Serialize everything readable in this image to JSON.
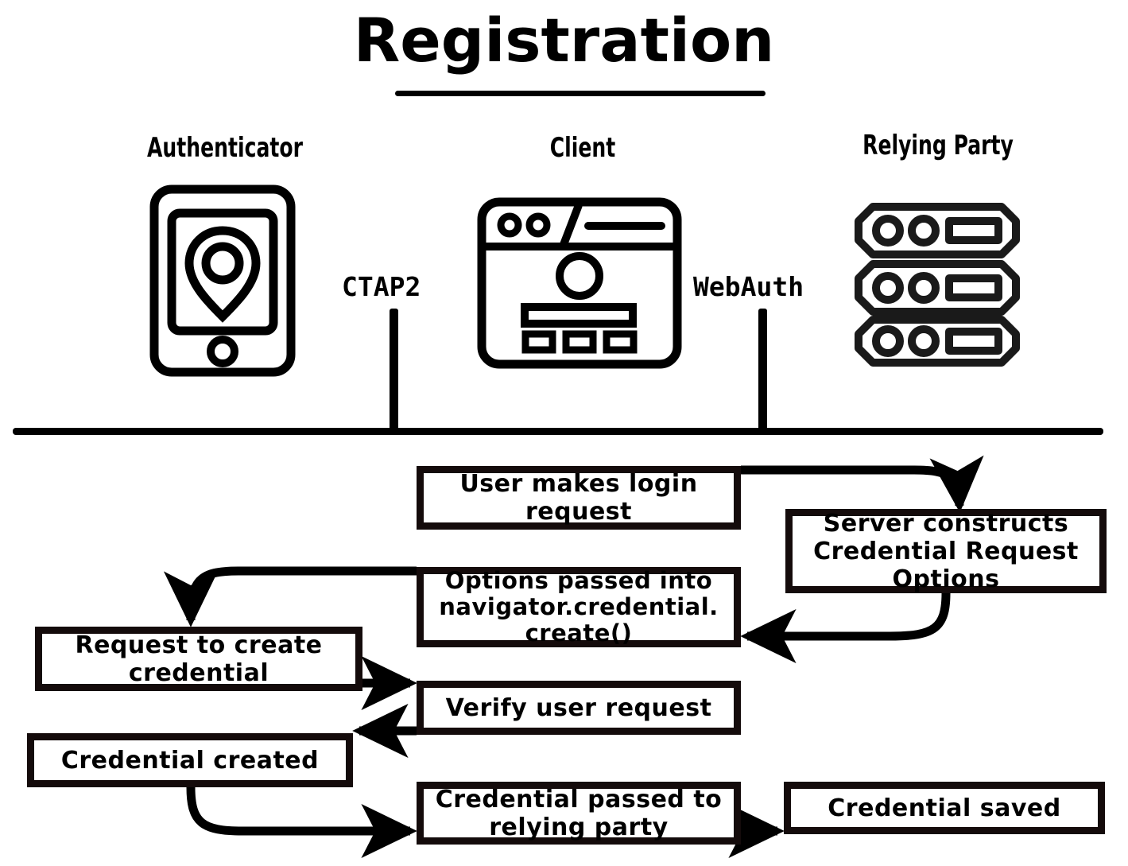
{
  "title": "Registration",
  "columns": [
    {
      "label": "Authenticator",
      "icon": "smartphone-location-icon"
    },
    {
      "label": "Client",
      "icon": "browser-window-icon"
    },
    {
      "label": "Relying Party",
      "icon": "server-rack-icon"
    }
  ],
  "protocols": [
    {
      "label": "CTAP2"
    },
    {
      "label": "WebAuth"
    }
  ],
  "flow": {
    "login_request": "User makes login\nrequest",
    "server_constructs": "Server constructs\nCredential Request\nOptions",
    "options_passed": "Options passed into\nnavigator.credential.\ncreate()",
    "request_create": "Request to create\ncredential",
    "verify_request": "Verify user request",
    "credential_created": "Credential created",
    "credential_passed": "Credential passed to\nrelying party",
    "credential_saved": "Credential saved"
  },
  "colors": {
    "ink": "#000000",
    "box_border": "#140b0b",
    "background": "#ffffff"
  }
}
